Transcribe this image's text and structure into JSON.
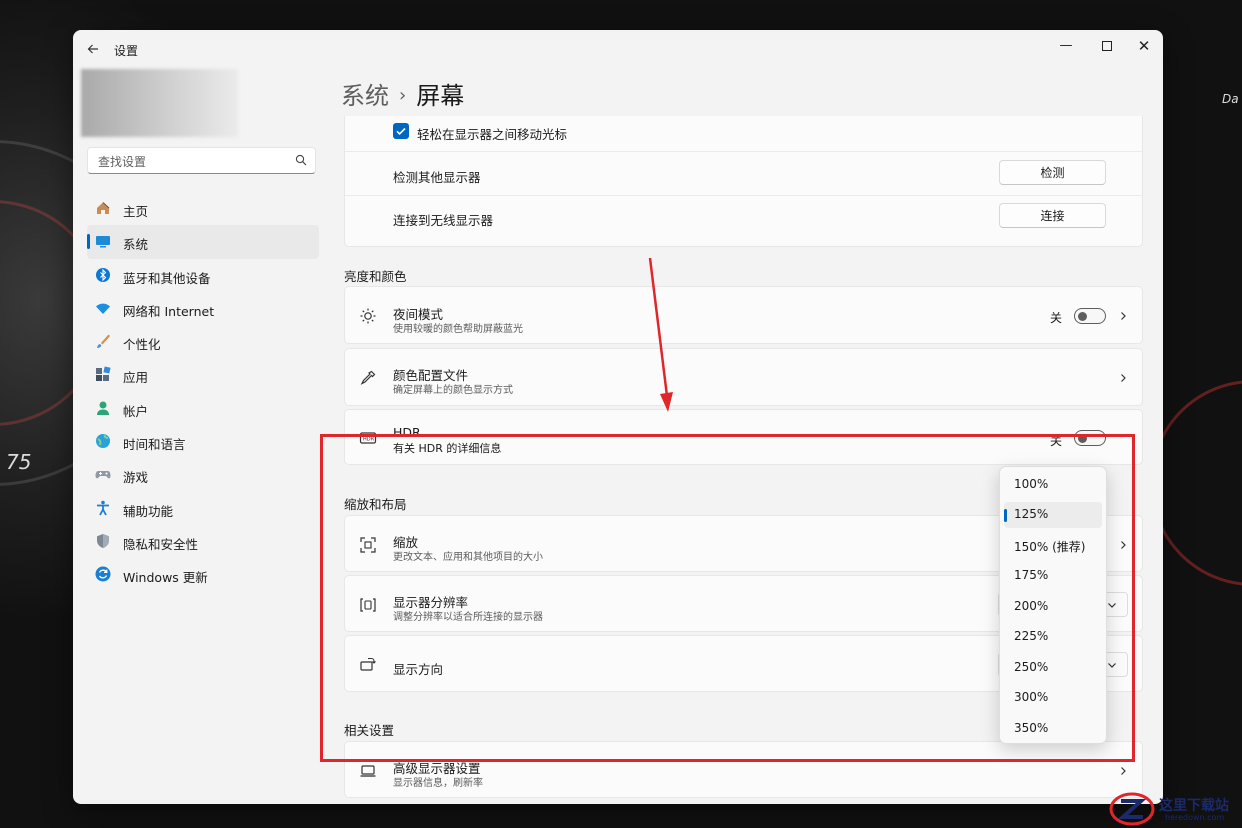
{
  "window": {
    "app_title": "设置",
    "controls": {
      "minimize": "—",
      "close": "✕"
    }
  },
  "sidebar": {
    "search_placeholder": "查找设置",
    "items": [
      {
        "label": "主页",
        "icon": "home-icon",
        "selected": false
      },
      {
        "label": "系统",
        "icon": "system-display-icon",
        "selected": true
      },
      {
        "label": "蓝牙和其他设备",
        "icon": "bluetooth-icon",
        "selected": false
      },
      {
        "label": "网络和 Internet",
        "icon": "wifi-icon",
        "selected": false
      },
      {
        "label": "个性化",
        "icon": "brush-icon",
        "selected": false
      },
      {
        "label": "应用",
        "icon": "apps-icon",
        "selected": false
      },
      {
        "label": "帐户",
        "icon": "account-icon",
        "selected": false
      },
      {
        "label": "时间和语言",
        "icon": "globe-clock-icon",
        "selected": false
      },
      {
        "label": "游戏",
        "icon": "gamepad-icon",
        "selected": false
      },
      {
        "label": "辅助功能",
        "icon": "accessibility-icon",
        "selected": false
      },
      {
        "label": "隐私和安全性",
        "icon": "shield-icon",
        "selected": false
      },
      {
        "label": "Windows 更新",
        "icon": "update-icon",
        "selected": false
      }
    ]
  },
  "breadcrumb": {
    "parent": "系统",
    "separator": "›",
    "current": "屏幕"
  },
  "multi_display": {
    "move_cursor_label": "轻松在显示器之间移动光标",
    "move_cursor_checked": true,
    "detect_label": "检测其他显示器",
    "detect_button": "检测",
    "wireless_label": "连接到无线显示器",
    "wireless_button": "连接"
  },
  "brightness_section": {
    "title": "亮度和颜色",
    "night_light": {
      "label": "夜间模式",
      "sub": "使用较暖的颜色帮助屏蔽蓝光",
      "state": "关"
    },
    "color_profile": {
      "label": "颜色配置文件",
      "sub": "确定屏幕上的颜色显示方式"
    },
    "hdr": {
      "label": "HDR",
      "sub": "有关 HDR 的详细信息",
      "state": "关"
    }
  },
  "scale_section": {
    "title": "缩放和布局",
    "scale": {
      "label": "缩放",
      "sub": "更改文本、应用和其他项目的大小"
    },
    "resolution": {
      "label": "显示器分辨率",
      "sub": "调整分辨率以适合所连接的显示器"
    },
    "orientation": {
      "label": "显示方向"
    }
  },
  "related_section": {
    "title": "相关设置",
    "advanced": {
      "label": "高级显示器设置",
      "sub": "显示器信息，刷新率"
    }
  },
  "scale_dropdown": {
    "selected_index": 1,
    "options": [
      "100%",
      "125%",
      "150% (推荐)",
      "175%",
      "200%",
      "225%",
      "250%",
      "300%",
      "350%"
    ]
  },
  "colors": {
    "accent": "#0067c0",
    "annotation_red": "#e0262b"
  },
  "watermark": {
    "text": "这里下载站",
    "url": "heredown.com"
  }
}
